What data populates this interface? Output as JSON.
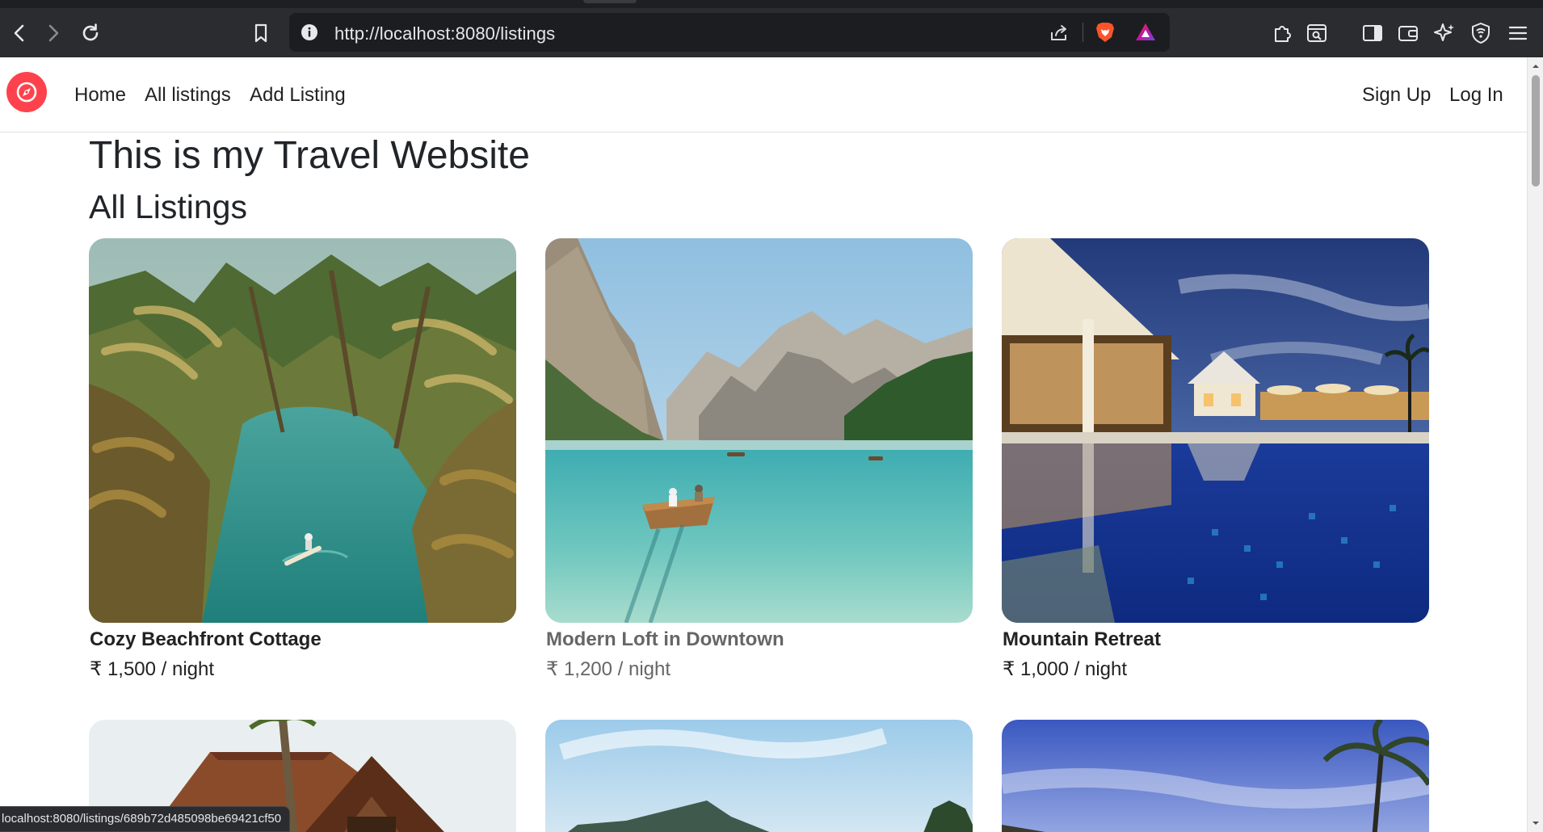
{
  "browser": {
    "url": "http://localhost:8080/listings",
    "status_url": "localhost:8080/listings/689b72d485098be69421cf50",
    "icons": {
      "back": "back-arrow-icon",
      "forward": "forward-arrow-icon",
      "reload": "reload-icon",
      "bookmark": "bookmark-icon",
      "site_info": "info-icon",
      "share": "share-icon",
      "shields": "brave-lion-icon",
      "rewards": "rewards-triangle-icon",
      "extensions": "puzzle-icon",
      "screenshot": "page-search-icon",
      "sidebar": "sidebar-icon",
      "wallet": "wallet-icon",
      "leo": "sparkle-icon",
      "vpn": "vpn-shield-icon",
      "menu": "hamburger-menu-icon"
    }
  },
  "navbar": {
    "brand_icon": "compass-icon",
    "brand_color": "#fe424d",
    "links": {
      "home": "Home",
      "all_listings": "All listings",
      "add_listing": "Add Listing",
      "sign_up": "Sign Up",
      "log_in": "Log In"
    }
  },
  "main": {
    "heading": "This is my Travel Website",
    "subheading": "All Listings",
    "listings": [
      {
        "title": "Cozy Beachfront Cottage",
        "price": "₹ 1,500 / night",
        "image": "tropical-river-palms"
      },
      {
        "title": "Modern Loft in Downtown",
        "price": "₹ 1,200 / night",
        "image": "mountain-lake-boat"
      },
      {
        "title": "Mountain Retreat",
        "price": "₹ 1,000 / night",
        "image": "resort-pool-night"
      },
      {
        "image": "wooden-cabin-roof"
      },
      {
        "image": "sky-island-palms"
      },
      {
        "image": "tropical-sky-palm"
      }
    ]
  }
}
